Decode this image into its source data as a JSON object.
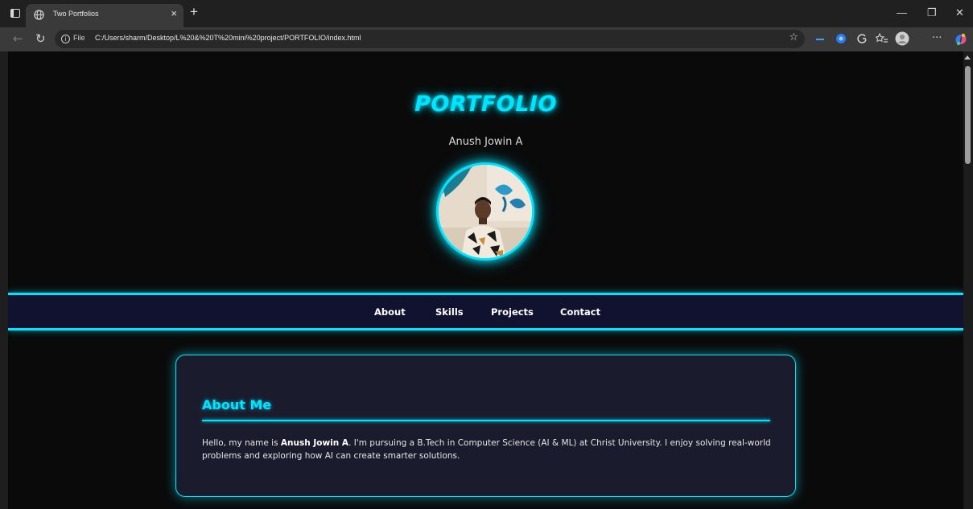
{
  "browser": {
    "tab_title": "Two Portfolios",
    "tab_close": "×",
    "new_tab": "+",
    "file_label": "File",
    "url": "C:/Users/sharm/Desktop/L%20&%20T%20mini%20project/PORTFOLIO/index.html",
    "minimize": "—",
    "restore": "❐",
    "close": "✕"
  },
  "header": {
    "title": "PORTFOLIO",
    "name": "Anush Jowin A"
  },
  "nav": {
    "items": [
      "About",
      "Skills",
      "Projects",
      "Contact"
    ]
  },
  "about": {
    "heading": "About Me",
    "text_before": "Hello, my name is ",
    "name_bold": "Anush Jowin A",
    "text_after": ". I'm pursuing a B.Tech in Computer Science (AI & ML) at Christ University. I enjoy solving real-world problems and exploring how AI can create smarter solutions."
  },
  "colors": {
    "accent": "#00e5ff",
    "nav_bg": "#111130",
    "card_bg": "#1b1b2e",
    "page_bg": "#0a0a0a"
  }
}
